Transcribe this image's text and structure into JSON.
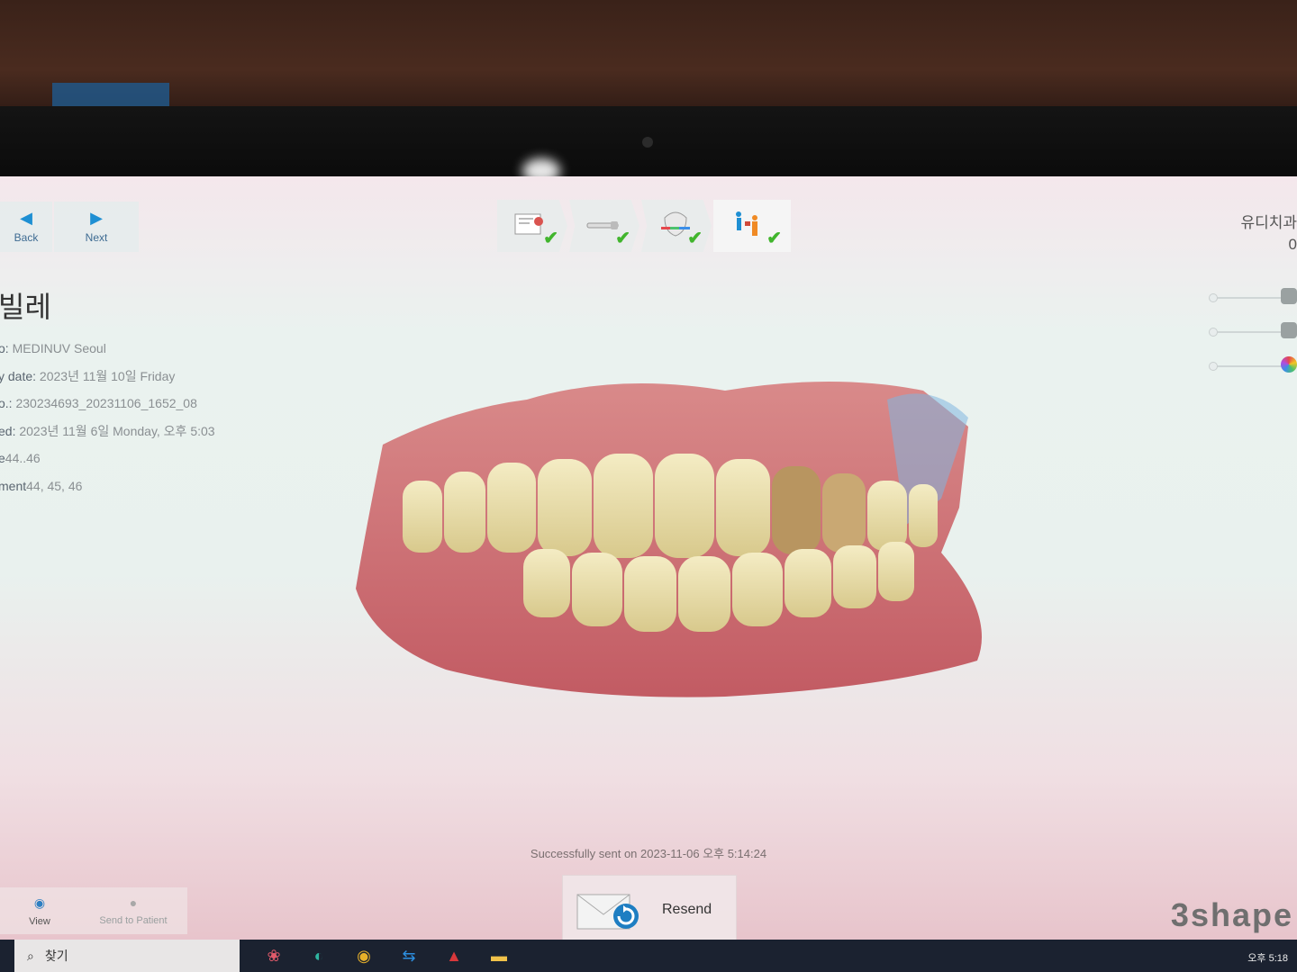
{
  "nav": {
    "back_label": "Back",
    "next_label": "Next"
  },
  "top_right": {
    "line1": "유디치과 ",
    "line2": "0"
  },
  "case": {
    "title": "빌레",
    "fields": [
      {
        "key": "o:",
        "value": " MEDINUV Seoul"
      },
      {
        "key": "y date:",
        "value": " 2023년 11월 10일 Friday"
      },
      {
        "key": "o.:",
        "value": " 230234693_20231106_1652_08"
      },
      {
        "key": "ed:",
        "value": " 2023년 11월 6일 Monday, 오후 5:03"
      },
      {
        "key": "e",
        "value": "44..46"
      },
      {
        "key": "ment",
        "value": "44, 45, 46"
      }
    ]
  },
  "status": {
    "text": "Successfully sent on 2023-11-06 오후 5:14:24"
  },
  "resend": {
    "label": "Resend"
  },
  "bottom_left": {
    "view_label": "View",
    "send_label": "Send to Patient"
  },
  "brand": {
    "text": "3shape"
  },
  "taskbar": {
    "search_placeholder": "찾기",
    "time": "오후 5:18"
  },
  "colors": {
    "accent": "#1e8fd3",
    "check": "#41b52d",
    "taskbar": "#1b2230"
  }
}
